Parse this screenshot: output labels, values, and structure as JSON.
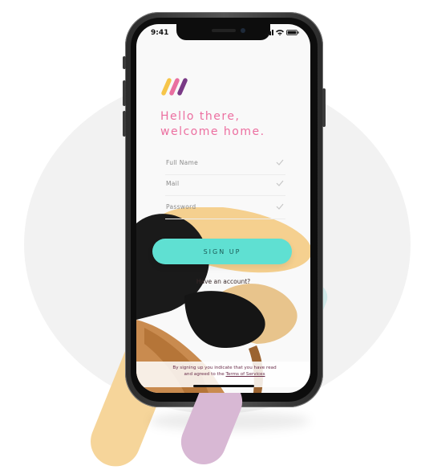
{
  "status": {
    "time": "9:41"
  },
  "welcome": {
    "line1": "Hello there,",
    "line2": "welcome home."
  },
  "form": {
    "full_name_label": "Full Name",
    "mail_label": "Mail",
    "password_label": "Password"
  },
  "actions": {
    "signup_label": "SIGN UP",
    "have_account_label": "Have an account?"
  },
  "footer": {
    "terms_prefix": "By signing up you indicate that you have read and agreed to the ",
    "terms_link": "Terms of Services"
  },
  "colors": {
    "accent_pink": "#ec6fa0",
    "button_teal": "#5fe0d2",
    "logo_yellow": "#f6c54a",
    "logo_pink": "#e96fa0",
    "logo_purple": "#7a3a86"
  },
  "icons": [
    "signal-icon",
    "wifi-icon",
    "battery-icon",
    "check-icon",
    "app-logo"
  ]
}
